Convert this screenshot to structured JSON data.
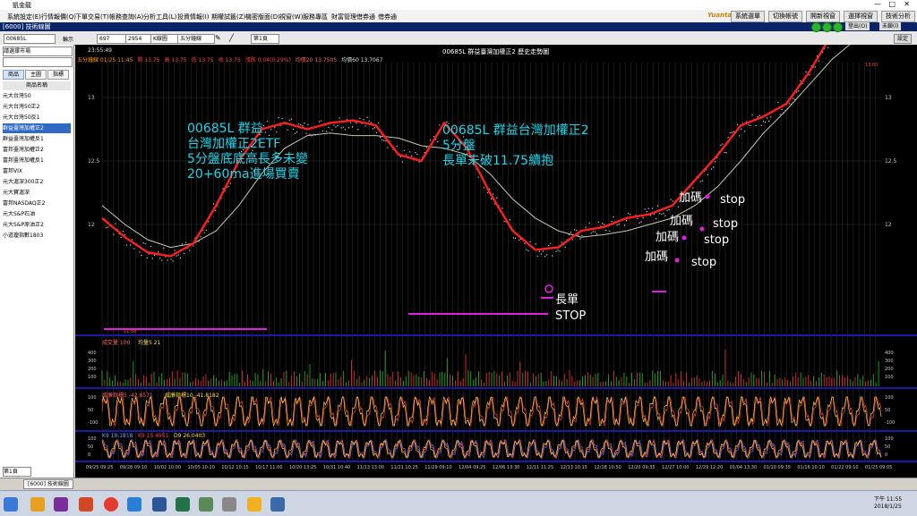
{
  "app": {
    "title": "凱金龍"
  },
  "menu": [
    "系統設定(E)",
    "行情報價(Q)",
    "下單交易(T)",
    "帳務查詢(A)",
    "分析工具(L)",
    "投資情報(I)",
    "期權試籤(Z)",
    "機密版面(D)",
    "視窗(W)",
    "服務專區",
    "財富管理",
    "借券通",
    "借券通"
  ],
  "top_buttons": [
    "系統選單",
    "切換帳號",
    "開新視窗",
    "選擇視窗",
    "技術分析"
  ],
  "top_right": {
    "logout": "登出(O)",
    "unlock": "未鎖(l)"
  },
  "window": {
    "title": "[6000] 技術線圖",
    "settings": "設定"
  },
  "toolbar": {
    "symbol": "00685L",
    "mode": "輪示",
    "count1": "697",
    "count2": "2954",
    "kbar": "K線圖",
    "interval": "五分鐘線",
    "page": "第1頁"
  },
  "left_panel": {
    "dropdown": "請選擇市場",
    "tabs": [
      "商品",
      "主圖",
      "指標"
    ],
    "header": "商品名稱",
    "items": [
      "元大台灣50",
      "元大台灣50正2",
      "元大台灣50反1",
      "群益臺灣加權正2",
      "群益臺灣加權反1",
      "富邦臺灣加權正2",
      "富邦臺灣加權反1",
      "富邦VIX",
      "元大滬深300正2",
      "元大寶滬深",
      "富邦NASDAQ正2",
      "元大S&P石油",
      "元大S&P原油正2",
      "小道瓊指數1803"
    ],
    "selected_index": 3,
    "bottom": "第1頁"
  },
  "chart_header": {
    "title": "00685L 群益臺灣加權正2 歷史走勢圖",
    "time": "23:55:49"
  },
  "chart_info": [
    {
      "label": "五分鐘線 01/25 11:45",
      "color": "#ff9900"
    },
    {
      "label": "開 13.75",
      "color": "#ff4040"
    },
    {
      "label": "高 13.75",
      "color": "#ff4040"
    },
    {
      "label": "低 13.75",
      "color": "#ff4040"
    },
    {
      "label": "收 13.75",
      "color": "#ff4040"
    },
    {
      "label": "漲跌 0.04(0.29%)",
      "color": "#ff4040"
    },
    {
      "label": "均價20 13.7505",
      "color": "#ff6666"
    },
    {
      "label": "均價60 13.7067",
      "color": "#dddddd"
    }
  ],
  "axis_y": [
    "13.5",
    "13",
    "12.5",
    "12"
  ],
  "volume_axis": [
    "400",
    "300",
    "200",
    "100"
  ],
  "kd_axis": [
    "100",
    "50",
    "-100"
  ],
  "kd_low_axis": [
    "100",
    "50",
    "0"
  ],
  "subcharts": {
    "volume": {
      "label": "成交量 100",
      "ma": "均量5 21"
    },
    "osc": {
      "label1": "威廉指標5 -42.8571",
      "label2": "威廉指標10 -41.8182"
    },
    "kd": {
      "label1": "K9 18.1818",
      "label2": "K9 15.4951",
      "label3": "D9 26.0403"
    }
  },
  "price_markers": {
    "high": "13.60",
    "low": "11.58"
  },
  "x_labels": [
    "09/25 09:25",
    "09/28 09:10",
    "10/02 10:00",
    "10/05 10:20",
    "10/12 10:15",
    "10/17 11:00",
    "10/20 13:25",
    "10/31 10:40",
    "11/13 13:00",
    "11/21 10:25",
    "11/29 09:10",
    "12/04 09:25",
    "12/06 13:30",
    "12/11 11:25",
    "12/13 10:15",
    "12/18 10:50",
    "12/20 09:35",
    "12/27 10:00",
    "12/29 12:20",
    "01/04 13:30",
    "01/10 09:35",
    "01/16 10:10",
    "01/22 09:10",
    "01/25 09:05"
  ],
  "annotations": {
    "left": [
      "00685L 群益",
      "台灣加權正2ETF",
      "5分盤底底高長多未變",
      "20+60ma進場買賣"
    ],
    "right": [
      "00685L 群益台灣加權正2",
      "5分盤",
      "長單未破11.75續抱"
    ],
    "long": "長單",
    "stop_big": "STOP",
    "adds": [
      "加碼",
      "加碼",
      "加碼",
      "加碼"
    ],
    "stops": [
      "stop",
      "stop",
      "stop",
      "stop"
    ]
  },
  "price_series": {
    "ma20": [
      12.05,
      11.9,
      11.78,
      11.75,
      11.85,
      12.15,
      12.5,
      12.75,
      12.8,
      12.75,
      12.8,
      12.82,
      12.78,
      12.55,
      12.5,
      12.8,
      12.6,
      12.25,
      11.95,
      11.8,
      11.82,
      11.95,
      11.98,
      12.05,
      12.08,
      12.15,
      12.35,
      12.55,
      12.78,
      12.85,
      12.95,
      13.2,
      13.5,
      13.6,
      13.55
    ],
    "ma60": [
      12.15,
      12.0,
      11.88,
      11.82,
      11.85,
      11.95,
      12.15,
      12.4,
      12.6,
      12.7,
      12.72,
      12.7,
      12.7,
      12.68,
      12.62,
      12.6,
      12.55,
      12.4,
      12.2,
      12.05,
      11.95,
      11.9,
      11.92,
      11.95,
      12.0,
      12.05,
      12.15,
      12.3,
      12.5,
      12.72,
      12.9,
      13.1,
      13.3,
      13.45,
      13.52
    ]
  },
  "status_bar": {
    "tab": "[6000] 技術線圖"
  },
  "taskbar": {
    "time": "下午 11:55",
    "date": "2018/1/25"
  }
}
